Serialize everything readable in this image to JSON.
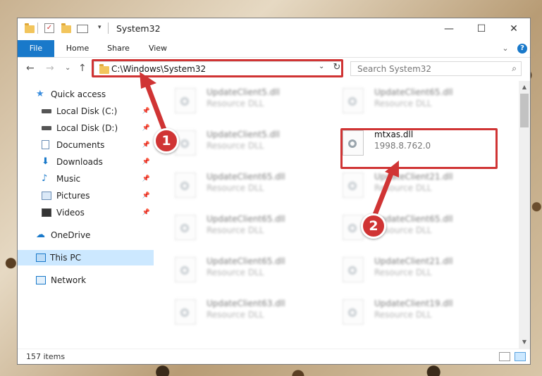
{
  "window": {
    "title": "System32",
    "minimize_glyph": "—",
    "maximize_glyph": "☐",
    "close_glyph": "✕"
  },
  "ribbon": {
    "tabs": [
      "File",
      "Home",
      "Share",
      "View"
    ],
    "expand_glyph": "⌄",
    "help_glyph": "?"
  },
  "nav": {
    "back_glyph": "←",
    "forward_glyph": "→",
    "recent_glyph": "⌄",
    "up_glyph": "↑",
    "address_path": "C:\\Windows\\System32",
    "address_drop_glyph": "⌄",
    "refresh_glyph": "↻",
    "search_placeholder": "Search System32",
    "search_glyph": "⌕"
  },
  "sidebar": {
    "pin_glyph": "📌",
    "items": [
      {
        "label": "Quick access",
        "icon": "star-icon",
        "pinned": false
      },
      {
        "label": "Local Disk (C:)",
        "icon": "drive-icon",
        "pinned": true
      },
      {
        "label": "Local Disk (D:)",
        "icon": "drive-icon",
        "pinned": true
      },
      {
        "label": "Documents",
        "icon": "document-icon",
        "pinned": true
      },
      {
        "label": "Downloads",
        "icon": "download-icon",
        "pinned": true
      },
      {
        "label": "Music",
        "icon": "music-icon",
        "pinned": true
      },
      {
        "label": "Pictures",
        "icon": "pictures-icon",
        "pinned": true
      },
      {
        "label": "Videos",
        "icon": "video-icon",
        "pinned": true
      },
      {
        "label": "OneDrive",
        "icon": "cloud-icon",
        "pinned": false
      },
      {
        "label": "This PC",
        "icon": "computer-icon",
        "pinned": false,
        "selected": true
      },
      {
        "label": "Network",
        "icon": "network-icon",
        "pinned": false
      }
    ]
  },
  "files": [
    {
      "name": "UpdateClient5.dll",
      "type": "Resource DLL"
    },
    {
      "name": "UpdateClient65.dll",
      "type": "Resource DLL"
    },
    {
      "name": "UpdateClient5.dll",
      "type": "Resource DLL"
    },
    {
      "name": "mtxas.dll",
      "type": "1998.8.762.0",
      "highlight": true
    },
    {
      "name": "UpdateClient65.dll",
      "type": "Resource DLL"
    },
    {
      "name": "UpdateClient21.dll",
      "type": "Resource DLL"
    },
    {
      "name": "UpdateClient65.dll",
      "type": "Resource DLL"
    },
    {
      "name": "UpdateClient65.dll",
      "type": "Resource DLL"
    },
    {
      "name": "UpdateClient65.dll",
      "type": "Resource DLL"
    },
    {
      "name": "UpdateClient21.dll",
      "type": "Resource DLL"
    },
    {
      "name": "UpdateClient63.dll",
      "type": "Resource DLL"
    },
    {
      "name": "UpdateClient19.dll",
      "type": "Resource DLL"
    }
  ],
  "status": {
    "item_count": "157 items"
  },
  "annotations": {
    "badge_1": "1",
    "badge_2": "2",
    "highlight_color": "#d03434"
  },
  "colors": {
    "accent": "#1979ca",
    "selection": "#cce8ff"
  }
}
